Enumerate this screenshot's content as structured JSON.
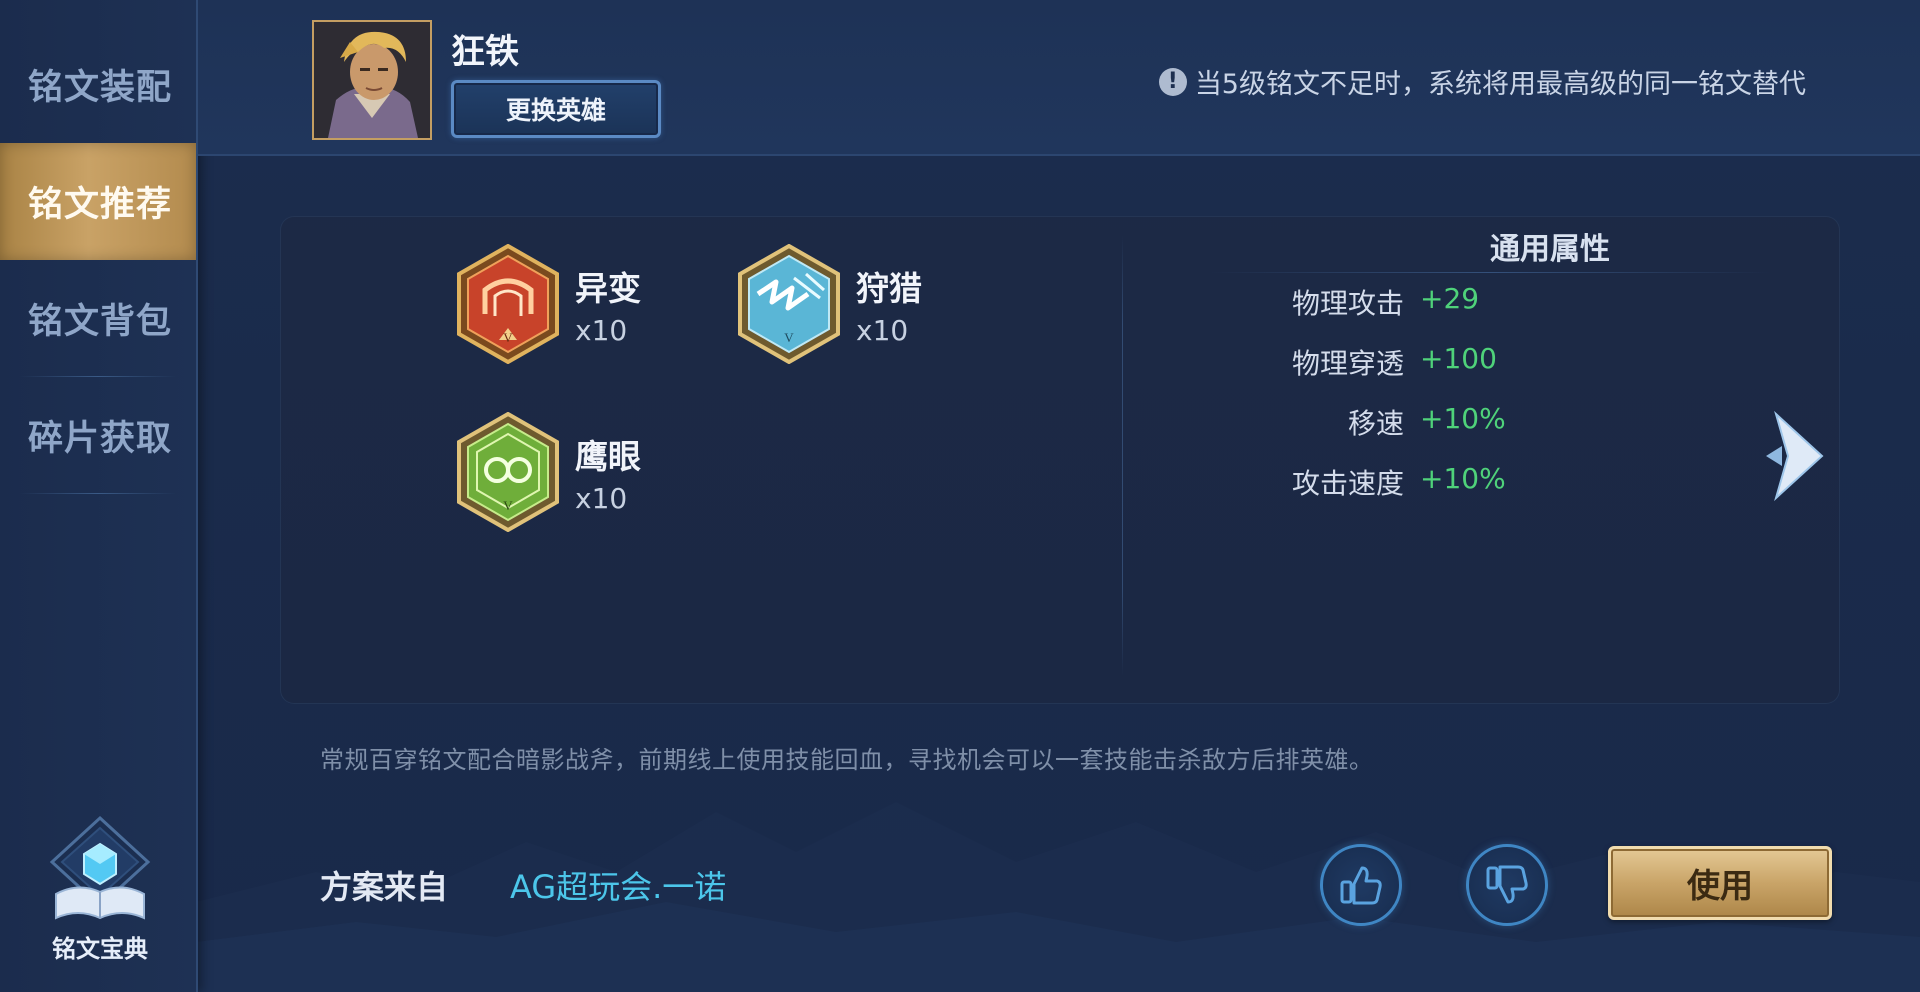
{
  "sidebar": {
    "items": [
      {
        "label": "铭文装配",
        "active": false
      },
      {
        "label": "铭文推荐",
        "active": true
      },
      {
        "label": "铭文背包",
        "active": false
      },
      {
        "label": "碎片获取",
        "active": false
      }
    ],
    "codex_label": "铭文宝典"
  },
  "header": {
    "hero_name": "狂铁",
    "change_hero_label": "更换英雄",
    "notice": "当5级铭文不足时，系统将用最高级的同一铭文替代"
  },
  "runes": [
    {
      "name": "异变",
      "count": "x10",
      "color": "#c9432a"
    },
    {
      "name": "狩猎",
      "count": "x10",
      "color": "#5ab6d6"
    },
    {
      "name": "鹰眼",
      "count": "x10",
      "color": "#6fae3a"
    }
  ],
  "attributes": {
    "title": "通用属性",
    "rows": [
      {
        "key": "物理攻击",
        "value": "+29"
      },
      {
        "key": "物理穿透",
        "value": "+100"
      },
      {
        "key": "移速",
        "value": "+10%"
      },
      {
        "key": "攻击速度",
        "value": "+10%"
      }
    ]
  },
  "description": "常规百穿铭文配合暗影战斧，前期线上使用技能回血，寻找机会可以一套技能击杀敌方后排英雄。",
  "footer": {
    "source_label": "方案来自",
    "source_value": "AG超玩会.一诺",
    "use_label": "使用"
  },
  "colors": {
    "accent_gold": "#c9a266",
    "stat_green": "#4fd27a",
    "link_blue": "#4cc6ea"
  }
}
